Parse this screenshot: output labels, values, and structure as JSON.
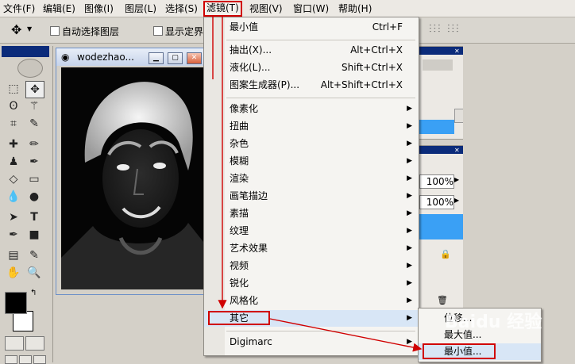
{
  "menubar": {
    "items": [
      "文件(F)",
      "编辑(E)",
      "图像(I)",
      "图层(L)",
      "选择(S)",
      "滤镜(T)",
      "视图(V)",
      "窗口(W)",
      "帮助(H)"
    ]
  },
  "options": {
    "auto_select_label": "自动选择图层",
    "show_bounds_label": "显示定界"
  },
  "document": {
    "title": "wodezhao..."
  },
  "filter_menu": {
    "last_filter": {
      "label": "最小值",
      "shortcut": "Ctrl+F"
    },
    "group2": [
      {
        "label": "抽出(X)...",
        "shortcut": "Alt+Ctrl+X"
      },
      {
        "label": "液化(L)...",
        "shortcut": "Shift+Ctrl+X"
      },
      {
        "label": "图案生成器(P)...",
        "shortcut": "Alt+Shift+Ctrl+X"
      }
    ],
    "submenus": [
      "像素化",
      "扭曲",
      "杂色",
      "模糊",
      "渲染",
      "画笔描边",
      "素描",
      "纹理",
      "艺术效果",
      "视频",
      "锐化",
      "风格化",
      "其它"
    ],
    "digimarc": "Digimarc"
  },
  "other_submenu": {
    "items": [
      "位移...",
      "最大值...",
      "最小值..."
    ]
  },
  "panels": {
    "zoom_a": "100%",
    "zoom_b": "100%"
  },
  "watermark": "Baidu 经验",
  "colors": {
    "highlight_red": "#d00000",
    "panel_blue": "#3aa0f5"
  }
}
